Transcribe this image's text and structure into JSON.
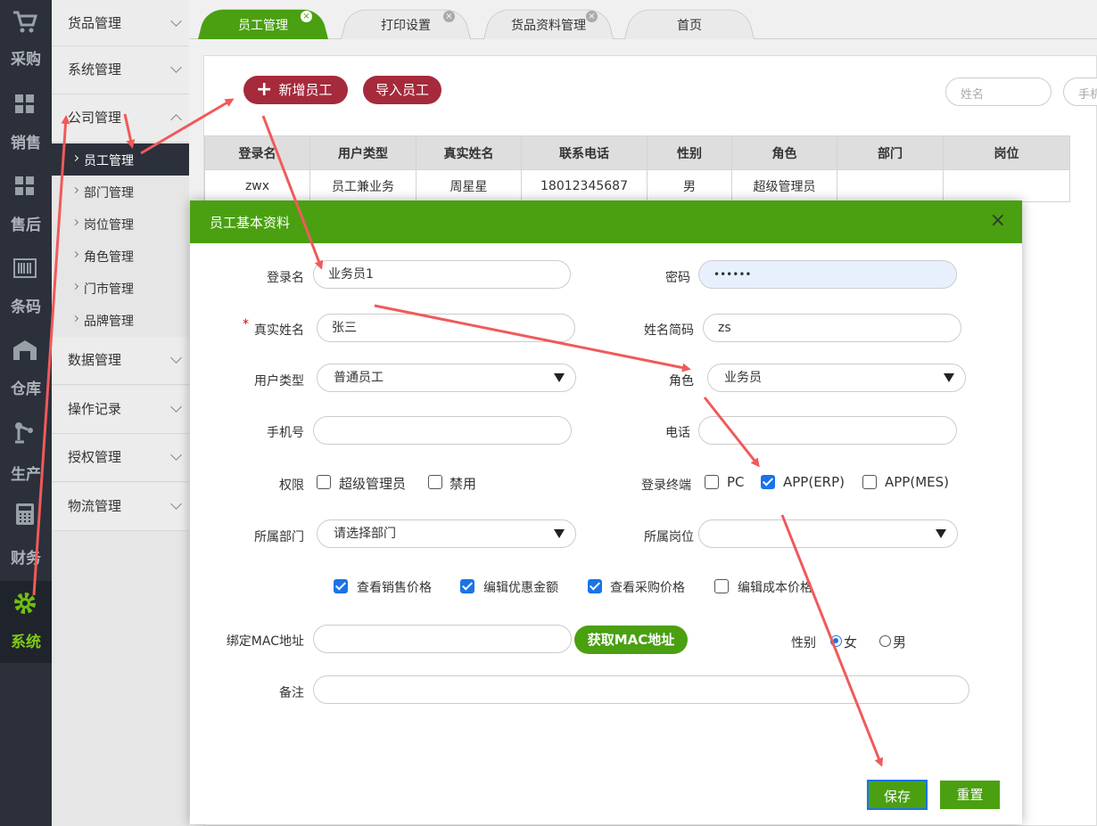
{
  "rail": [
    {
      "label": "采购",
      "icon": "cart-icon"
    },
    {
      "label": "销售",
      "icon": "boxes-icon"
    },
    {
      "label": "售后",
      "icon": "boxes-icon"
    },
    {
      "label": "条码",
      "icon": "barcode-icon"
    },
    {
      "label": "仓库",
      "icon": "warehouse-icon"
    },
    {
      "label": "生产",
      "icon": "robot-arm-icon"
    },
    {
      "label": "财务",
      "icon": "calculator-icon"
    },
    {
      "label": "系统",
      "icon": "gear-icon",
      "active": true
    }
  ],
  "sidebar": {
    "menus_top": [
      "货品管理",
      "系统管理",
      "公司管理"
    ],
    "submenus": [
      "员工管理",
      "部门管理",
      "岗位管理",
      "角色管理",
      "门市管理",
      "品牌管理"
    ],
    "menus_bottom": [
      "数据管理",
      "操作记录",
      "授权管理",
      "物流管理"
    ]
  },
  "tabs": [
    "员工管理",
    "打印设置",
    "货品资料管理",
    "首页"
  ],
  "toolbar": {
    "add_label": "新增员工",
    "import_label": "导入员工",
    "search_name_placeholder": "姓名",
    "search_phone_placeholder": "手机"
  },
  "table": {
    "headers": [
      "登录名",
      "用户类型",
      "真实姓名",
      "联系电话",
      "性别",
      "角色",
      "部门",
      "岗位"
    ],
    "rows": [
      [
        "zwx",
        "员工兼业务",
        "周星星",
        "18012345687",
        "男",
        "超级管理员",
        "",
        ""
      ]
    ]
  },
  "modal": {
    "title": "员工基本资料",
    "close": "×",
    "fields": {
      "login_label": "登录名",
      "login_value": "业务员1",
      "password_label": "密码",
      "password_value": "••••••",
      "realname_label": "真实姓名",
      "realname_value": "张三",
      "shortname_label": "姓名简码",
      "shortname_value": "zs",
      "usertype_label": "用户类型",
      "usertype_value": "普通员工",
      "role_label": "角色",
      "role_value": "业务员",
      "mobile_label": "手机号",
      "mobile_value": "",
      "phone_label": "电话",
      "phone_value": "",
      "perm_label": "权限",
      "perm_superadmin": "超级管理员",
      "perm_disable": "禁用",
      "terminal_label": "登录终端",
      "term_pc": "PC",
      "term_app_erp": "APP(ERP)",
      "term_app_mes": "APP(MES)",
      "dept_label": "所属部门",
      "dept_value": "请选择部门",
      "post_label": "所属岗位",
      "post_value": "",
      "view_sale": "查看销售价格",
      "edit_discount": "编辑优惠金额",
      "view_purchase": "查看采购价格",
      "edit_cost": "编辑成本价格",
      "mac_label": "绑定MAC地址",
      "mac_value": "",
      "mac_button": "获取MAC地址",
      "gender_label": "性别",
      "gender_female": "女",
      "gender_male": "男",
      "remark_label": "备注",
      "remark_value": ""
    },
    "checks": {
      "perm_superadmin": false,
      "perm_disable": false,
      "term_pc": false,
      "term_app_erp": true,
      "term_app_mes": false,
      "view_sale": true,
      "edit_discount": true,
      "view_purchase": true,
      "edit_cost": false
    },
    "gender_selected": "女",
    "save_label": "保存",
    "reset_label": "重置"
  },
  "colors": {
    "accent_green": "#4aa010",
    "accent_red": "#a52a3b",
    "annotation_arrow": "#f05a5a"
  }
}
